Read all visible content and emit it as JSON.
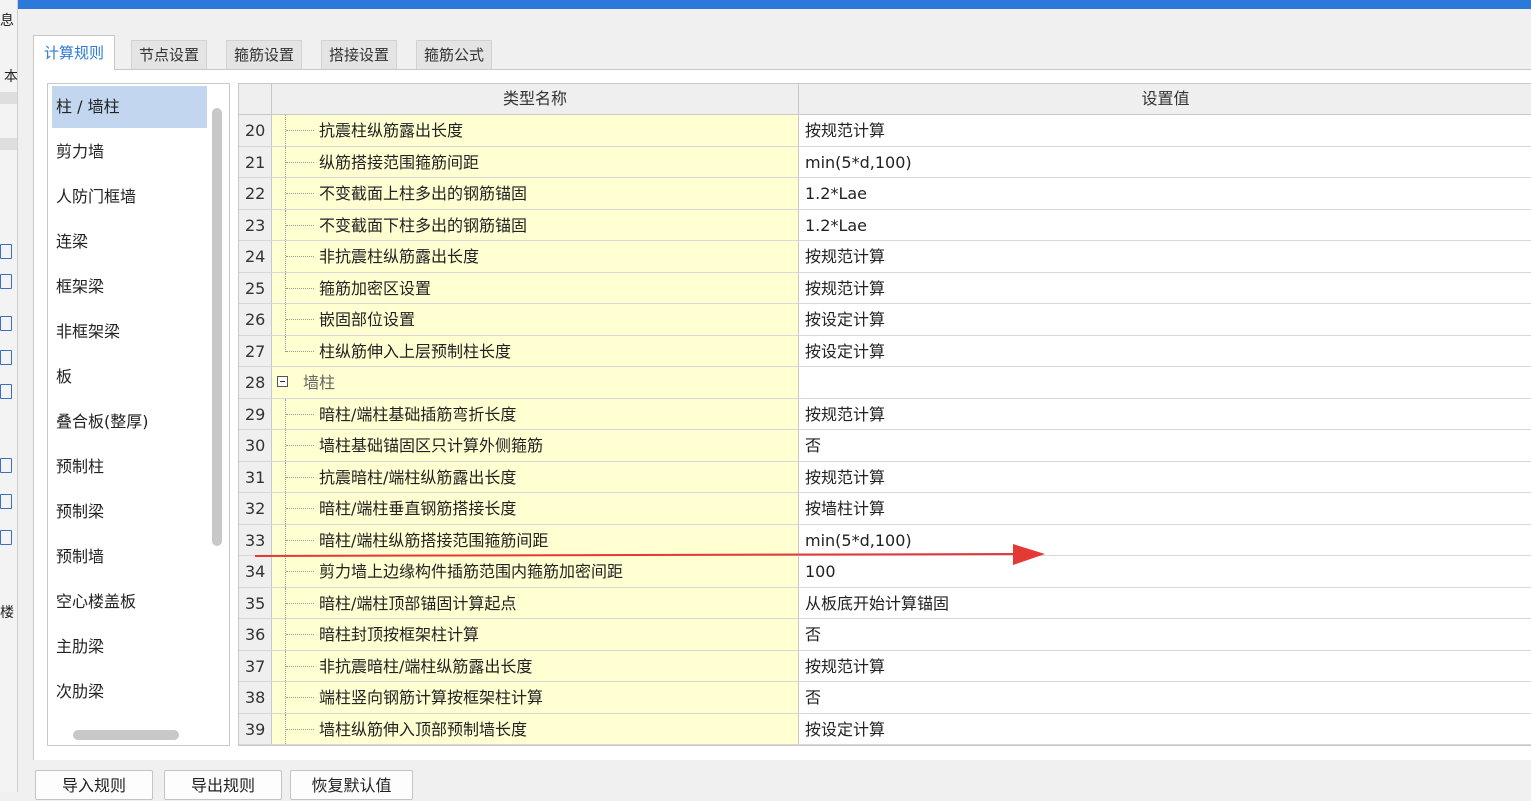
{
  "window": {
    "accent_color": "#2b79d8"
  },
  "left_strip": {
    "text_fragments": [
      "息",
      "本",
      "楼"
    ]
  },
  "tabs": [
    {
      "label": "计算规则",
      "active": true
    },
    {
      "label": "节点设置",
      "active": false
    },
    {
      "label": "箍筋设置",
      "active": false
    },
    {
      "label": "搭接设置",
      "active": false
    },
    {
      "label": "箍筋公式",
      "active": false
    }
  ],
  "categories": [
    {
      "label": "柱 / 墙柱",
      "selected": true
    },
    {
      "label": "剪力墙"
    },
    {
      "label": "人防门框墙"
    },
    {
      "label": "连梁"
    },
    {
      "label": "框架梁"
    },
    {
      "label": "非框架梁"
    },
    {
      "label": "板"
    },
    {
      "label": "叠合板(整厚)"
    },
    {
      "label": "预制柱"
    },
    {
      "label": "预制梁"
    },
    {
      "label": "预制墙"
    },
    {
      "label": "空心楼盖板"
    },
    {
      "label": "主肋梁"
    },
    {
      "label": "次肋梁"
    }
  ],
  "table": {
    "headers": {
      "name": "类型名称",
      "value": "设置值"
    },
    "rows": [
      {
        "num": "20",
        "name": "抗震柱纵筋露出长度",
        "value": "按规范计算"
      },
      {
        "num": "21",
        "name": "纵筋搭接范围箍筋间距",
        "value": "min(5*d,100)"
      },
      {
        "num": "22",
        "name": "不变截面上柱多出的钢筋锚固",
        "value": "1.2*Lae"
      },
      {
        "num": "23",
        "name": "不变截面下柱多出的钢筋锚固",
        "value": "1.2*Lae"
      },
      {
        "num": "24",
        "name": "非抗震柱纵筋露出长度",
        "value": "按规范计算"
      },
      {
        "num": "25",
        "name": "箍筋加密区设置",
        "value": "按规范计算"
      },
      {
        "num": "26",
        "name": "嵌固部位设置",
        "value": "按设定计算"
      },
      {
        "num": "27",
        "name": "柱纵筋伸入上层预制柱长度",
        "value": "按设定计算",
        "last": true
      },
      {
        "num": "28",
        "name": "墙柱",
        "value": "",
        "group": true
      },
      {
        "num": "29",
        "name": "暗柱/端柱基础插筋弯折长度",
        "value": "按规范计算"
      },
      {
        "num": "30",
        "name": "墙柱基础锚固区只计算外侧箍筋",
        "value": "否"
      },
      {
        "num": "31",
        "name": "抗震暗柱/端柱纵筋露出长度",
        "value": "按规范计算"
      },
      {
        "num": "32",
        "name": "暗柱/端柱垂直钢筋搭接长度",
        "value": "按墙柱计算"
      },
      {
        "num": "33",
        "name": "暗柱/端柱纵筋搭接范围箍筋间距",
        "value": "min(5*d,100)"
      },
      {
        "num": "34",
        "name": "剪力墙上边缘构件插筋范围内箍筋加密间距",
        "value": "100"
      },
      {
        "num": "35",
        "name": "暗柱/端柱顶部锚固计算起点",
        "value": "从板底开始计算锚固"
      },
      {
        "num": "36",
        "name": "暗柱封顶按框架柱计算",
        "value": "否"
      },
      {
        "num": "37",
        "name": "非抗震暗柱/端柱纵筋露出长度",
        "value": "按规范计算"
      },
      {
        "num": "38",
        "name": "端柱竖向钢筋计算按框架柱计算",
        "value": "否"
      },
      {
        "num": "39",
        "name": "墙柱纵筋伸入顶部预制墙长度",
        "value": "按设定计算"
      }
    ]
  },
  "annotation": {
    "color": "#e53935"
  },
  "buttons": {
    "import": "导入规则",
    "export": "导出规则",
    "restore": "恢复默认值"
  }
}
